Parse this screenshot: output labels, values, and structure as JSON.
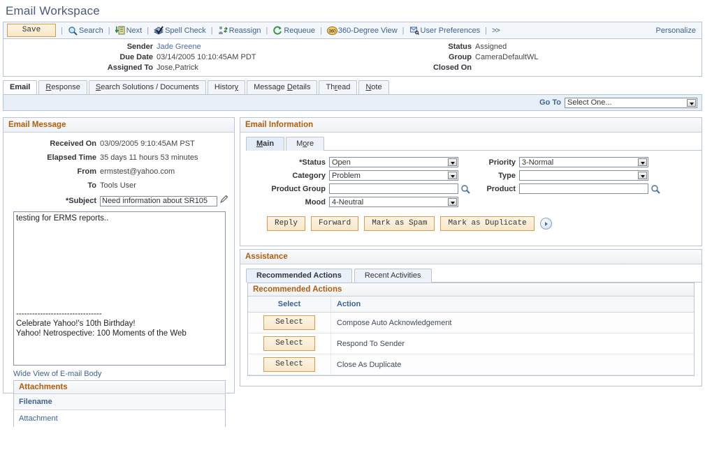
{
  "page": {
    "title": "Email Workspace"
  },
  "toolbar": {
    "save_label": "Save",
    "items": [
      {
        "label": "Search",
        "icon": "search-icon"
      },
      {
        "label": "Next",
        "icon": "next-icon"
      },
      {
        "label": "Spell Check",
        "icon": "spell-check-icon"
      },
      {
        "label": "Reassign",
        "icon": "reassign-icon"
      },
      {
        "label": "Requeue",
        "icon": "requeue-icon"
      },
      {
        "label": "360-Degree View",
        "icon": "360-view-icon"
      },
      {
        "label": "User Preferences",
        "icon": "user-preferences-icon"
      }
    ],
    "more_label": ">>",
    "personalize_label": "Personalize"
  },
  "summary": {
    "left": [
      {
        "label": "Sender",
        "value": "Jade Greene",
        "link": true
      },
      {
        "label": "Due Date",
        "value": "03/14/2005 10:10:45AM PDT",
        "link": false
      },
      {
        "label": "Assigned To",
        "value": "Jose,Patrick",
        "link": false
      }
    ],
    "right": [
      {
        "label": "Status",
        "value": "Assigned"
      },
      {
        "label": "Group",
        "value": "CameraDefaultWL"
      },
      {
        "label": "Closed On",
        "value": ""
      }
    ]
  },
  "tabs": [
    {
      "label": "Email",
      "accesskey": "",
      "active": true
    },
    {
      "label": "Response",
      "accesskey": "R",
      "active": false
    },
    {
      "label": "Search Solutions / Documents",
      "accesskey": "S",
      "active": false
    },
    {
      "label": "History",
      "accesskey": "y",
      "active": false
    },
    {
      "label": "Message Details",
      "accesskey": "D",
      "active": false
    },
    {
      "label": "Thread",
      "accesskey": "r",
      "active": false
    },
    {
      "label": "Note",
      "accesskey": "N",
      "active": false
    }
  ],
  "goto": {
    "label": "Go To",
    "value": "Select One..."
  },
  "email_message": {
    "panel_title": "Email Message",
    "fields": [
      {
        "label": "Received On",
        "value": "03/09/2005  9:10:45AM PST"
      },
      {
        "label": "Elapsed Time",
        "value": "35 days 11 hours 53 minutes"
      },
      {
        "label": "From",
        "value": "ermstest@yahoo.com"
      },
      {
        "label": "To",
        "value": "Tools User"
      }
    ],
    "subject_label": "*Subject",
    "subject_value": "Need information about SR105",
    "body_text": "testing for ERMS reports..",
    "body_separator": "--------------------------------",
    "body_footer_line1": "Celebrate Yahoo!'s 10th Birthday!",
    "body_footer_line2": "Yahoo! Netrospective: 100 Moments of the Web",
    "wide_view_label": "Wide View of E-mail Body"
  },
  "attachments": {
    "panel_title": "Attachments",
    "column_header": "Filename",
    "rows": [
      {
        "name": "Attachment"
      }
    ]
  },
  "email_information": {
    "panel_title": "Email Information",
    "subtabs": [
      {
        "label": "Main",
        "accesskey": "M",
        "active": true
      },
      {
        "label": "More",
        "accesskey": "o",
        "active": false
      }
    ],
    "fields_left": [
      {
        "label": "*Status",
        "value": "Open",
        "type": "select"
      },
      {
        "label": "Category",
        "value": "Problem",
        "type": "select"
      },
      {
        "label": "Product Group",
        "value": "",
        "type": "lookup"
      },
      {
        "label": "Mood",
        "value": "4-Neutral",
        "type": "select"
      }
    ],
    "fields_right": [
      {
        "label": "Priority",
        "value": "3-Normal",
        "type": "select"
      },
      {
        "label": "Type",
        "value": "",
        "type": "select"
      },
      {
        "label": "Product",
        "value": "",
        "type": "lookup"
      }
    ],
    "buttons": [
      "Reply",
      "Forward",
      "Mark as Spam",
      "Mark as Duplicate"
    ]
  },
  "assistance": {
    "panel_title": "Assistance",
    "subtabs": [
      {
        "label": "Recommended Actions",
        "active": true
      },
      {
        "label": "Recent Activities",
        "active": false
      }
    ],
    "grid_title": "Recommended Actions",
    "columns": [
      "Select",
      "Action"
    ],
    "rows": [
      {
        "select_label": "Select",
        "action": "Compose Auto Acknowledgement"
      },
      {
        "select_label": "Select",
        "action": "Respond To Sender"
      },
      {
        "select_label": "Select",
        "action": "Close As Duplicate"
      }
    ]
  },
  "colors": {
    "panel_header_text": "#b05e0d",
    "link": "#3c6394",
    "title": "#4a5a78",
    "button_border": "#d79b4a"
  }
}
